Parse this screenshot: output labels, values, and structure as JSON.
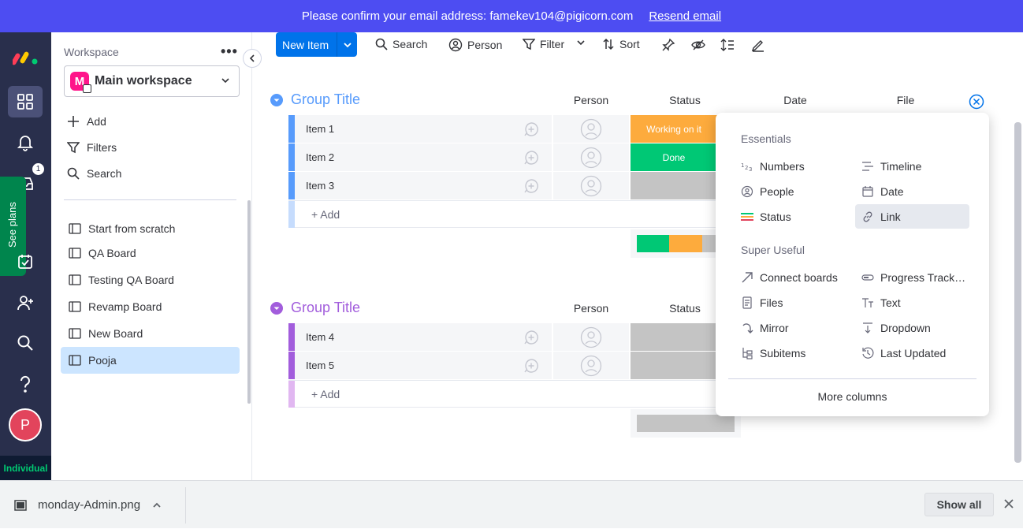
{
  "banner": {
    "message": "Please confirm your email address: famekev104@pigicorn.com",
    "link": "Resend email"
  },
  "rail": {
    "see_plans": "See plans",
    "notif_count": "1",
    "avatar_letter": "P",
    "plan_label": "Individual"
  },
  "sidebar": {
    "workspace_label": "Workspace",
    "more": "•••",
    "workspace_initial": "M",
    "workspace_name": "Main workspace",
    "actions": {
      "add": "Add",
      "filters": "Filters",
      "search": "Search"
    },
    "boards": [
      "Start from scratch",
      "QA Board",
      "Testing QA Board",
      "Revamp Board",
      "New Board",
      "Pooja"
    ]
  },
  "toolbar": {
    "new_item": "New Item",
    "search": "Search",
    "person": "Person",
    "filter": "Filter",
    "sort": "Sort"
  },
  "groups": [
    {
      "title": "Group Title",
      "color": "#579bfc",
      "columns": {
        "person": "Person",
        "status": "Status",
        "date": "Date",
        "file": "File"
      },
      "items": [
        {
          "name": "Item 1",
          "status": "Working on it",
          "status_color": "#fdab3d"
        },
        {
          "name": "Item 2",
          "status": "Done",
          "status_color": "#00c875"
        },
        {
          "name": "Item 3",
          "status": "",
          "status_color": "#c4c4c4"
        }
      ],
      "add_label": "+ Add"
    },
    {
      "title": "Group Title",
      "color": "#a25ddc",
      "columns": {
        "person": "Person",
        "status": "Status"
      },
      "items": [
        {
          "name": "Item 4",
          "status": "",
          "status_color": "#c4c4c4"
        },
        {
          "name": "Item 5",
          "status": "",
          "status_color": "#c4c4c4"
        }
      ],
      "add_label": "+ Add"
    }
  ],
  "column_picker": {
    "essentials_title": "Essentials",
    "essentials": [
      "Numbers",
      "Timeline",
      "People",
      "Date",
      "Status",
      "Link"
    ],
    "super_useful_title": "Super Useful",
    "super_useful": [
      "Connect boards",
      "Progress Track…",
      "Files",
      "Text",
      "Mirror",
      "Dropdown",
      "Subitems",
      "Last Updated"
    ],
    "more": "More columns"
  },
  "downloads": {
    "file": "monday-Admin.png",
    "show_all": "Show all"
  }
}
